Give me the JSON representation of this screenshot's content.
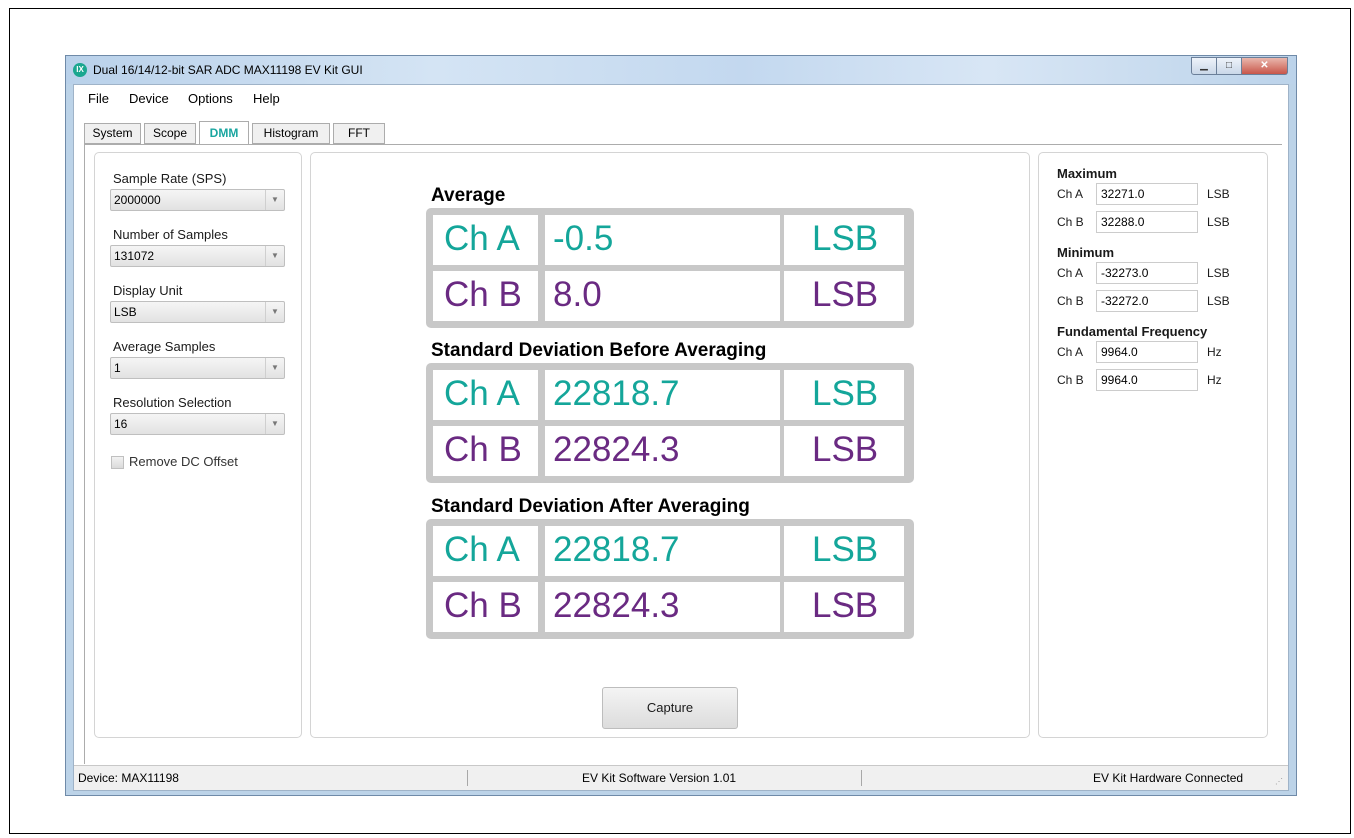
{
  "window": {
    "title": "Dual 16/14/12-bit SAR ADC MAX11198 EV Kit GUI",
    "app_icon": "maxim-logo-icon"
  },
  "menu": [
    "File",
    "Device",
    "Options",
    "Help"
  ],
  "tabs": [
    {
      "label": "System",
      "active": false
    },
    {
      "label": "Scope",
      "active": false
    },
    {
      "label": "DMM",
      "active": true
    },
    {
      "label": "Histogram",
      "active": false
    },
    {
      "label": "FFT",
      "active": false
    }
  ],
  "settings": {
    "sample_rate": {
      "label": "Sample Rate (SPS)",
      "value": "2000000"
    },
    "num_samples": {
      "label": "Number of Samples",
      "value": "131072"
    },
    "display_unit": {
      "label": "Display Unit",
      "value": "LSB"
    },
    "average_samples": {
      "label": "Average Samples",
      "value": "1"
    },
    "resolution": {
      "label": "Resolution Selection",
      "value": "16"
    },
    "remove_dc": {
      "label": "Remove DC Offset",
      "checked": false
    }
  },
  "stats": [
    {
      "title": "Average",
      "rows": [
        {
          "channel": "Ch A",
          "value": "-0.5",
          "unit": "LSB"
        },
        {
          "channel": "Ch B",
          "value": "8.0",
          "unit": "LSB"
        }
      ]
    },
    {
      "title": "Standard Deviation Before Averaging",
      "rows": [
        {
          "channel": "Ch A",
          "value": "22818.7",
          "unit": "LSB"
        },
        {
          "channel": "Ch B",
          "value": "22824.3",
          "unit": "LSB"
        }
      ]
    },
    {
      "title": "Standard Deviation After Averaging",
      "rows": [
        {
          "channel": "Ch A",
          "value": "22818.7",
          "unit": "LSB"
        },
        {
          "channel": "Ch B",
          "value": "22824.3",
          "unit": "LSB"
        }
      ]
    }
  ],
  "capture_label": "Capture",
  "right": {
    "maximum": {
      "title": "Maximum",
      "rows": [
        {
          "channel": "Ch A",
          "value": "32271.0",
          "unit": "LSB"
        },
        {
          "channel": "Ch B",
          "value": "32288.0",
          "unit": "LSB"
        }
      ]
    },
    "minimum": {
      "title": "Minimum",
      "rows": [
        {
          "channel": "Ch A",
          "value": "-32273.0",
          "unit": "LSB"
        },
        {
          "channel": "Ch B",
          "value": "-32272.0",
          "unit": "LSB"
        }
      ]
    },
    "fundamental": {
      "title": "Fundamental Frequency",
      "rows": [
        {
          "channel": "Ch A",
          "value": "9964.0",
          "unit": "Hz"
        },
        {
          "channel": "Ch B",
          "value": "9964.0",
          "unit": "Hz"
        }
      ]
    }
  },
  "status": {
    "device": "Device: MAX11198",
    "version": "EV Kit Software Version 1.01",
    "hardware": "EV Kit Hardware Connected"
  },
  "colors": {
    "channel_a": "#14a69a",
    "channel_b": "#6a2a82",
    "active_tab": "#1aa6a0"
  }
}
